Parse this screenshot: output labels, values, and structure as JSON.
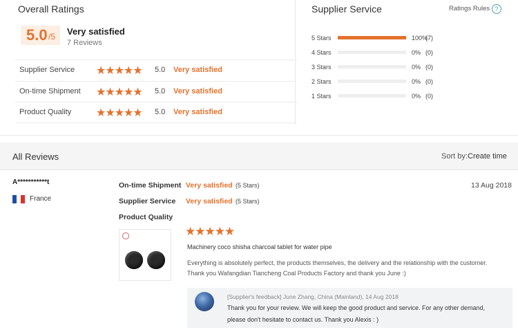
{
  "overall": {
    "title": "Overall Ratings",
    "score": "5.0",
    "score_max": "/5",
    "verdict": "Very satisfied",
    "review_count": "7 Reviews"
  },
  "categories": [
    {
      "label": "Supplier Service",
      "stars": "★★★★★",
      "score": "5.0",
      "verdict": "Very satisfied"
    },
    {
      "label": "On-time Shipment",
      "stars": "★★★★★",
      "score": "5.0",
      "verdict": "Very satisfied"
    },
    {
      "label": "Product Quality",
      "stars": "★★★★★",
      "score": "5.0",
      "verdict": "Very satisfied"
    }
  ],
  "supplier_service": {
    "title": "Supplier Service",
    "rules_label": "Ratings Rules",
    "help_glyph": "?",
    "distribution": [
      {
        "label": "5 Stars",
        "percent": "100%",
        "count": "(7)",
        "fraction": 1.0
      },
      {
        "label": "4 Stars",
        "percent": "0%",
        "count": "(0)",
        "fraction": 0
      },
      {
        "label": "3 Stars",
        "percent": "0%",
        "count": "(0)",
        "fraction": 0
      },
      {
        "label": "2 Stars",
        "percent": "0%",
        "count": "(0)",
        "fraction": 0
      },
      {
        "label": "1 Stars",
        "percent": "0%",
        "count": "(0)",
        "fraction": 0
      }
    ]
  },
  "all_reviews": {
    "title": "All Reviews",
    "sort_label": "Sort by:",
    "sort_value": "Create time"
  },
  "review": {
    "reviewer": "A***********t",
    "country": "France",
    "date": "13 Aug 2018",
    "shipment_label": "On-time Shipment",
    "shipment_verdict": "Very satisfied",
    "shipment_stars": "(5 Stars)",
    "service_label": "Supplier Service",
    "service_verdict": "Very satisfied",
    "service_stars": "(5 Stars)",
    "quality_label": "Product Quality",
    "quality_stars": "★★★★★",
    "product_name": "Machinery coco shisha charcoal tablet for water pipe",
    "text_line1": "Everything is absolutely perfect, the products themselves, the delivery and the relationship with the customer.",
    "text_line2": "Thank you Wafangdian Tiancheng Coal Products Factory and thank you June :)"
  },
  "feedback": {
    "meta": "[Supplier's feedback] June Zhang, China (Mainland), 14 Aug 2018",
    "line1": "Thank you for your review. We will keep the good product and service. For any other demand,",
    "line2": "please don't hesitate to contact us. Thank you Alexis : )"
  },
  "colors": {
    "accent": "#e3722d",
    "score_bg": "#fdeee3",
    "flag_blue": "#1f4ea3",
    "flag_white": "#ffffff",
    "flag_red": "#d8322f"
  }
}
